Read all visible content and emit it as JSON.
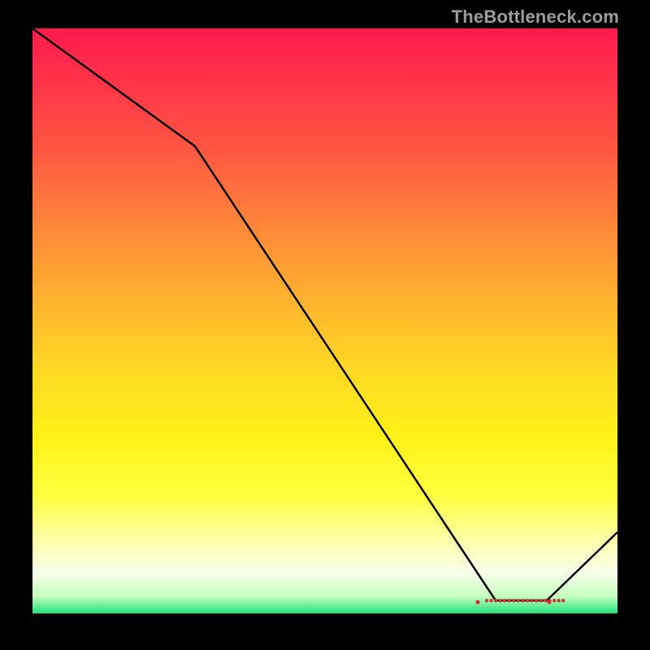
{
  "watermark": "TheBottleneck.com",
  "tiny_label": "●●●●●●●●●●●●●●●●●●",
  "chart_data": {
    "type": "line",
    "title": "",
    "xlabel": "",
    "ylabel": "",
    "xlim": [
      0,
      100
    ],
    "ylim": [
      0,
      100
    ],
    "grid": false,
    "legend": false,
    "series": [
      {
        "name": "curve",
        "x": [
          0,
          28,
          79,
          88,
          100
        ],
        "y": [
          100,
          80,
          2,
          2,
          14
        ]
      }
    ],
    "annotations": [
      {
        "type": "marker-strip",
        "x_range": [
          76,
          88
        ],
        "y": 2,
        "color": "#d62f2f"
      }
    ],
    "gradient_stops": [
      {
        "pos": 0,
        "color": "#ff1a4d"
      },
      {
        "pos": 20,
        "color": "#ff5442"
      },
      {
        "pos": 45,
        "color": "#ffae30"
      },
      {
        "pos": 70,
        "color": "#fff218"
      },
      {
        "pos": 93,
        "color": "#f8ffea"
      },
      {
        "pos": 100,
        "color": "#22e27a"
      }
    ]
  }
}
